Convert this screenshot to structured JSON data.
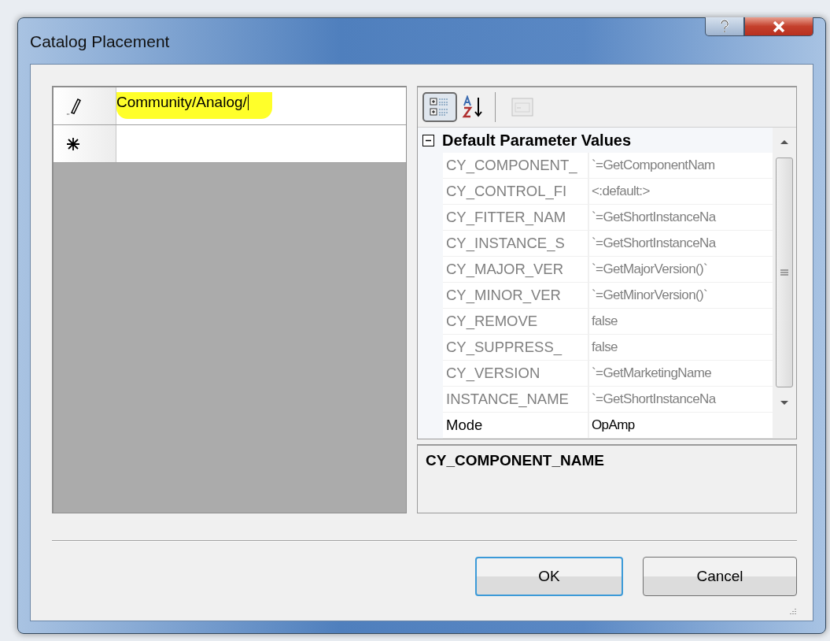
{
  "window": {
    "title": "Catalog Placement"
  },
  "paths_grid": {
    "rows": [
      {
        "kind": "editing",
        "value": "Community/Analog/",
        "highlighted": true
      },
      {
        "kind": "new",
        "value": ""
      }
    ]
  },
  "property_grid": {
    "toolbar": [
      {
        "kind": "categorized",
        "selected": true,
        "disabled": false
      },
      {
        "kind": "alphabetical",
        "selected": false,
        "disabled": false
      },
      {
        "kind": "property-pages",
        "selected": false,
        "disabled": true
      }
    ],
    "category": {
      "label": "Default Parameter Values",
      "expanded": true
    },
    "properties": [
      {
        "name": "CY_COMPONENT_",
        "value": "`=GetComponentNam",
        "readonly": true
      },
      {
        "name": "CY_CONTROL_FI",
        "value": "<:default:>",
        "readonly": true
      },
      {
        "name": "CY_FITTER_NAM",
        "value": "`=GetShortInstanceNa",
        "readonly": true
      },
      {
        "name": "CY_INSTANCE_S",
        "value": "`=GetShortInstanceNa",
        "readonly": true
      },
      {
        "name": "CY_MAJOR_VER",
        "value": "`=GetMajorVersion()`",
        "readonly": true
      },
      {
        "name": "CY_MINOR_VER",
        "value": "`=GetMinorVersion()`",
        "readonly": true
      },
      {
        "name": "CY_REMOVE",
        "value": "false",
        "readonly": true
      },
      {
        "name": "CY_SUPPRESS_",
        "value": "false",
        "readonly": true
      },
      {
        "name": "CY_VERSION",
        "value": "`=GetMarketingName",
        "readonly": true
      },
      {
        "name": "INSTANCE_NAME",
        "value": "`=GetShortInstanceNa",
        "readonly": true
      },
      {
        "name": "Mode",
        "value": "OpAmp",
        "readonly": false
      }
    ],
    "description": {
      "title": "CY_COMPONENT_NAME"
    }
  },
  "buttons": [
    {
      "label": "OK",
      "default": true
    },
    {
      "label": "Cancel",
      "default": false
    }
  ]
}
